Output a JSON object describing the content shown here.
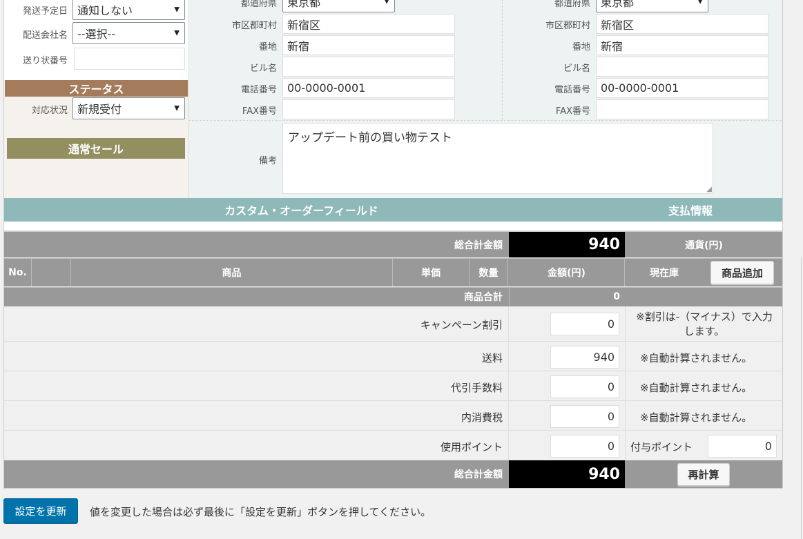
{
  "left_panel": {
    "ship_date_label": "発送予定日",
    "ship_date_value": "通知しない",
    "carrier_label": "配送会社名",
    "carrier_value": "--選択--",
    "tracking_label": "送り状番号",
    "tracking_value": "",
    "status_header": "ステータス",
    "status_label": "対応状況",
    "status_value": "新規受付",
    "sale_badge": "通常セール"
  },
  "address_left": {
    "prefecture_label": "都道府県",
    "prefecture_value": "東京都",
    "city_label": "市区郡町村",
    "city_value": "新宿区",
    "street_label": "番地",
    "street_value": "新宿",
    "building_label": "ビル名",
    "building_value": "",
    "phone_label": "電話番号",
    "phone_value": "00-0000-0001",
    "fax_label": "FAX番号",
    "fax_value": ""
  },
  "address_right": {
    "prefecture_label": "都道府県",
    "prefecture_value": "東京都",
    "city_label": "市区郡町村",
    "city_value": "新宿区",
    "street_label": "番地",
    "street_value": "新宿",
    "building_label": "ビル名",
    "building_value": "",
    "phone_label": "電話番号",
    "phone_value": "00-0000-0001",
    "fax_label": "FAX番号",
    "fax_value": ""
  },
  "memo": {
    "label": "備考",
    "value": "アップデート前の買い物テスト"
  },
  "section_bar": {
    "custom_fields": "カスタム・オーダーフィールド",
    "payment_info": "支払情報"
  },
  "order_table": {
    "total_label": "総合計金額",
    "total_value": "940",
    "currency_label": "通貨(円)",
    "col_no": "No.",
    "col_product": "商品",
    "col_unit_price": "単価",
    "col_qty": "数量",
    "col_amount": "金額(円)",
    "col_stock": "現在庫",
    "add_product_button": "商品追加",
    "subtotal_label": "商品合計",
    "subtotal_value": "0",
    "campaign_label": "キャンペーン割引",
    "campaign_value": "0",
    "campaign_note": "※割引は-（マイナス）で入力します。",
    "shipping_label": "送料",
    "shipping_value": "940",
    "shipping_note": "※自動計算されません。",
    "cod_label": "代引手数料",
    "cod_value": "0",
    "cod_note": "※自動計算されません。",
    "tax_label": "内消費税",
    "tax_value": "0",
    "tax_note": "※自動計算されません。",
    "points_used_label": "使用ポイント",
    "points_used_value": "0",
    "points_given_label": "付与ポイント",
    "points_given_value": "0",
    "grand_total_label": "総合計金額",
    "grand_total_value": "940",
    "recalc_button": "再計算"
  },
  "footer": {
    "update_button": "設定を更新",
    "message": "値を変更した場合は必ず最後に「設定を更新」ボタンを押してください。"
  },
  "colors": {
    "status_header_bg": "#a47c5b",
    "sale_badge_bg": "#948f60",
    "section_bar_bg": "#8fb8b8",
    "table_header_bg": "#999999",
    "total_value_bg": "#000000",
    "primary_button_bg": "#0073aa"
  }
}
